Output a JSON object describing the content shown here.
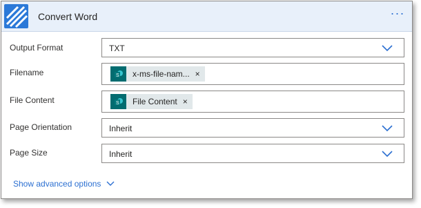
{
  "header": {
    "title": "Convert Word",
    "more_label": "···",
    "logo_icon": "stripes-logo-icon",
    "color": "#2b79d8"
  },
  "fields": {
    "output_format": {
      "label": "Output Format",
      "value": "TXT"
    },
    "filename": {
      "label": "Filename",
      "token_label": "x-ms-file-nam...",
      "token_close": "×",
      "token_icon": "sharepoint-icon"
    },
    "file_content": {
      "label": "File Content",
      "token_label": "File Content",
      "token_close": "×",
      "token_icon": "sharepoint-icon"
    },
    "page_orientation": {
      "label": "Page Orientation",
      "value": "Inherit"
    },
    "page_size": {
      "label": "Page Size",
      "value": "Inherit"
    }
  },
  "advanced": {
    "label": "Show advanced options"
  },
  "colors": {
    "accent": "#2b6fd1",
    "token_bg": "#e1e8ea",
    "sharepoint": "#036c70"
  }
}
